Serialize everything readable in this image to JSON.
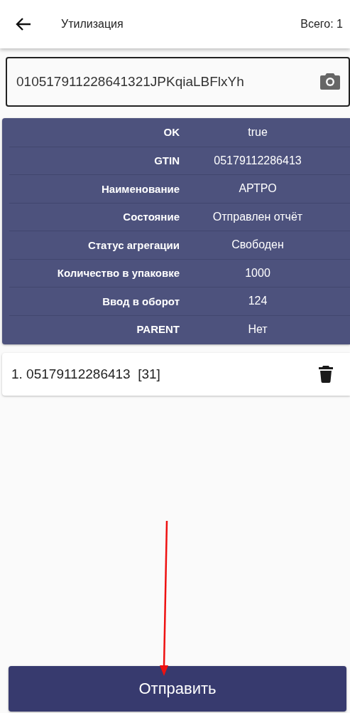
{
  "header": {
    "title": "Утилизация",
    "total": "Всего: 1"
  },
  "scan_field": {
    "value": "010517911228641321JPKqiaLBFlxYh"
  },
  "details": [
    {
      "label": "OK",
      "value": "true"
    },
    {
      "label": "GTIN",
      "value": "05179112286413"
    },
    {
      "label": "Наименование",
      "value": "АРТРО"
    },
    {
      "label": "Состояние",
      "value": "Отправлен отчёт"
    },
    {
      "label": "Статус агрегации",
      "value": "Свободен"
    },
    {
      "label": "Количество в упаковке",
      "value": "1000"
    },
    {
      "label": "Ввод в оборот",
      "value": "124"
    },
    {
      "label": "PARENT",
      "value": "Нет"
    }
  ],
  "items": [
    {
      "text": "1. 05179112286413  [31]"
    }
  ],
  "submit_button": "Отправить"
}
